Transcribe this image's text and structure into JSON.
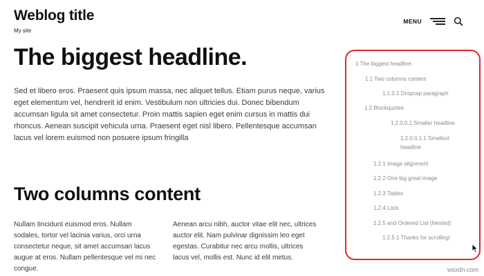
{
  "header": {
    "site_title": "Weblog title",
    "site_description": "My site",
    "menu_label": "MENU"
  },
  "main": {
    "headline": "The biggest headline.",
    "paragraph": "Sed et libero eros. Praesent quis ipsum massa, nec aliquet tellus. Etiam purus neque, varius eget elementum vel, hendrerit id enim. Vestibulum non ultricies dui. Donec bibendum accumsan ligula sit amet consectetur. Proin mattis sapien eget enim cursus in mattis dui rhoncus. Aenean suscipit vehicula urna. Praesent eget nisl libero. Pellentesque accumsan lacus vel lorem euismod non posuere ipsum fringilla",
    "subheadline": "Two columns content",
    "column_1": "Nullam tincidunt euismod eros. Nullam sodales, tortor vel lacinia varius, orci urna consectetur neque, sit amet accumsan lacus augue at eros. Nullam pellentesque vel mi nec congue.",
    "column_2": "Aenean arcu nibh, auctor vitae elit nec, ultrices auctor elit. Nam pulvinar dignissim leo eget egestas. Curabitur nec arcu mollis, ultrices lacus vel, mollis est. Nunc id elit metus."
  },
  "toc": {
    "highlight_color": "#e0262b",
    "items": [
      "1 The biggest headline.",
      "1.1 Two columns content",
      "1.1.0.1 Dropcap paragraph",
      "1.2 Blockquotes",
      "1.2.0.0.1 Smaller headline",
      "1.2.0.0.1.1 Smallest headline",
      "1.2.1 Image alignment",
      "1.2.2 One big great image",
      "1.2.3 Tables",
      "1.2.4 Lists",
      "1.2.5 and Ordered List (Nested)",
      "1.2.5.1 Thanks for scrolling!"
    ]
  },
  "watermark": "wsxdn.com"
}
